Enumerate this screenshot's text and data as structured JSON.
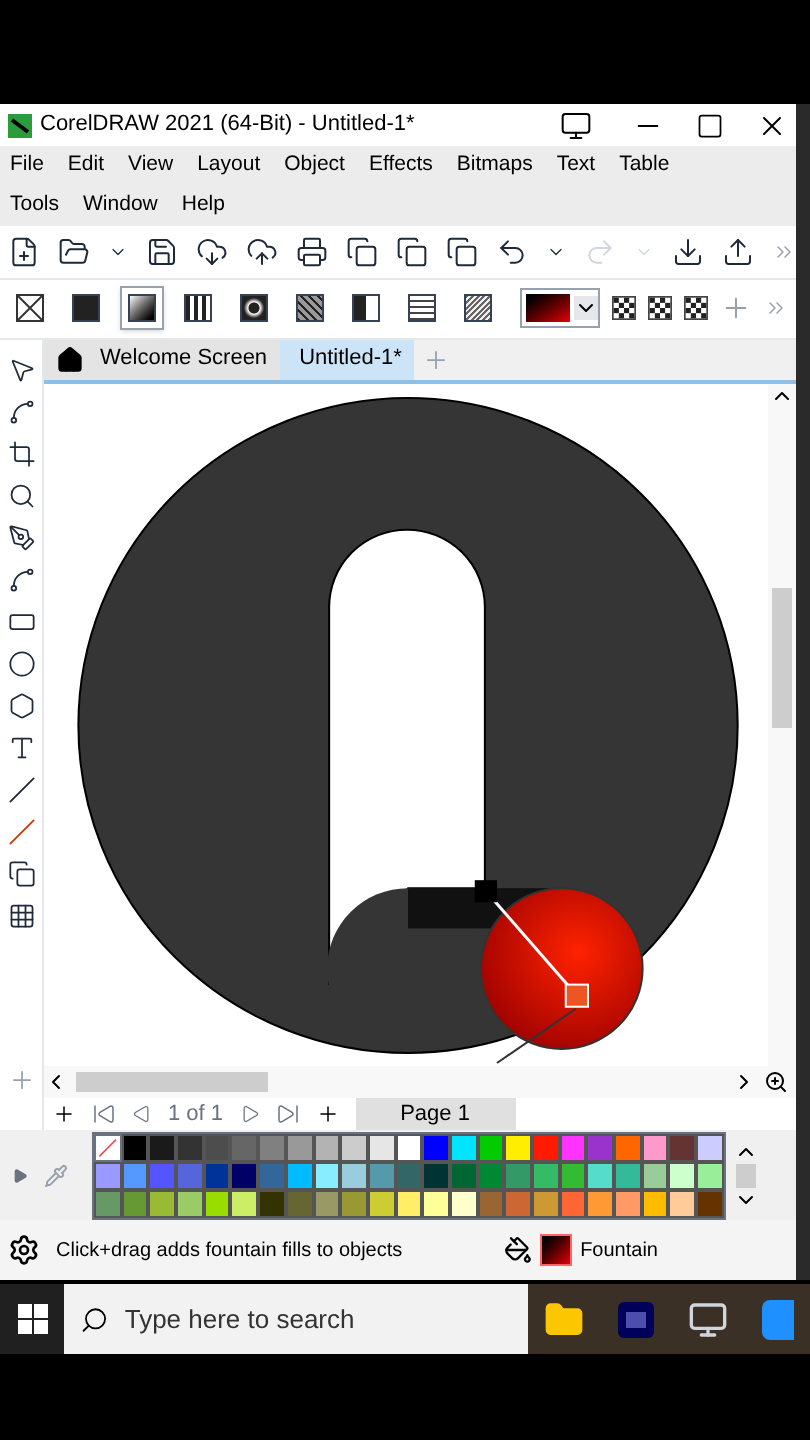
{
  "window": {
    "title": "CorelDRAW 2021 (64-Bit) - Untitled-1*"
  },
  "menu": [
    "File",
    "Edit",
    "View",
    "Layout",
    "Object",
    "Effects",
    "Bitmaps",
    "Text",
    "Table",
    "Tools",
    "Window",
    "Help"
  ],
  "fill_types": [
    {
      "kind": "none",
      "selected": false
    },
    {
      "kind": "uniform",
      "selected": false
    },
    {
      "kind": "fountain",
      "selected": true
    },
    {
      "kind": "vector",
      "selected": false
    },
    {
      "kind": "bitmap",
      "selected": false
    },
    {
      "kind": "pattern",
      "selected": false
    },
    {
      "kind": "half",
      "selected": false
    },
    {
      "kind": "texture",
      "selected": false
    },
    {
      "kind": "postscript",
      "selected": false
    }
  ],
  "tabs": [
    {
      "label": "Welcome Screen",
      "selected": false,
      "kind": "home"
    },
    {
      "label": "Untitled-1*",
      "selected": true,
      "kind": "document"
    }
  ],
  "page_nav": {
    "count": "1 of 1",
    "pages": [
      {
        "label": "Page 1",
        "selected": true
      }
    ]
  },
  "palette": {
    "no_color": true,
    "rows": [
      [
        {
          "color": "#000000"
        },
        {
          "color": "#1a1a1a"
        },
        {
          "color": "#333333"
        },
        {
          "color": "#4d4d4d"
        },
        {
          "color": "#666666"
        },
        {
          "color": "#808080"
        },
        {
          "color": "#999999"
        },
        {
          "color": "#b3b3b3"
        },
        {
          "color": "#cccccc"
        },
        {
          "color": "#e6e6e6"
        },
        {
          "color": "#ffffff"
        },
        {
          "color": "#0000ff"
        },
        {
          "color": "#00e5ff"
        },
        {
          "color": "#00cc00"
        },
        {
          "color": "#ffee00"
        },
        {
          "color": "#ff1a00"
        },
        {
          "color": "#ff33ff"
        },
        {
          "color": "#9933cc"
        },
        {
          "color": "#ff6600"
        },
        {
          "color": "#ff99cc"
        },
        {
          "color": "#663333"
        },
        {
          "color": "#ccccff"
        }
      ],
      [
        {
          "color": "#9999ff"
        },
        {
          "color": "#5599ff"
        },
        {
          "color": "#5555ff"
        },
        {
          "color": "#5566dd"
        },
        {
          "color": "#003399"
        },
        {
          "color": "#000066"
        },
        {
          "color": "#336699"
        },
        {
          "color": "#00bbff"
        },
        {
          "color": "#88eeff"
        },
        {
          "color": "#99ccdd"
        },
        {
          "color": "#5599aa"
        },
        {
          "color": "#336666"
        },
        {
          "color": "#003333"
        },
        {
          "color": "#006633"
        },
        {
          "color": "#008833"
        },
        {
          "color": "#339966"
        },
        {
          "color": "#33bb66"
        },
        {
          "color": "#33bb33"
        },
        {
          "color": "#55ddcc"
        },
        {
          "color": "#33bb99"
        },
        {
          "color": "#99cc99"
        },
        {
          "color": "#ccffcc"
        },
        {
          "color": "#99ee99"
        }
      ],
      [
        {
          "color": "#669966"
        },
        {
          "color": "#669933"
        },
        {
          "color": "#99bb33"
        },
        {
          "color": "#99cc66"
        },
        {
          "color": "#99dd00"
        },
        {
          "color": "#ccee66"
        },
        {
          "color": "#333300"
        },
        {
          "color": "#666633"
        },
        {
          "color": "#999966"
        },
        {
          "color": "#999933"
        },
        {
          "color": "#cccc33"
        },
        {
          "color": "#ffee66"
        },
        {
          "color": "#ffff99"
        },
        {
          "color": "#ffffcc"
        },
        {
          "color": "#996633"
        },
        {
          "color": "#cc6633"
        },
        {
          "color": "#cc9933"
        },
        {
          "color": "#ff6633"
        },
        {
          "color": "#ff9933"
        },
        {
          "color": "#ff9966"
        },
        {
          "color": "#ffbb00"
        },
        {
          "color": "#ffcc99"
        },
        {
          "color": "#663300"
        }
      ]
    ]
  },
  "status": {
    "hint": "Click+drag adds fountain fills to objects",
    "fill_label": "Fountain"
  },
  "taskbar": {
    "search": {
      "placeholder": "Type here to search"
    }
  }
}
